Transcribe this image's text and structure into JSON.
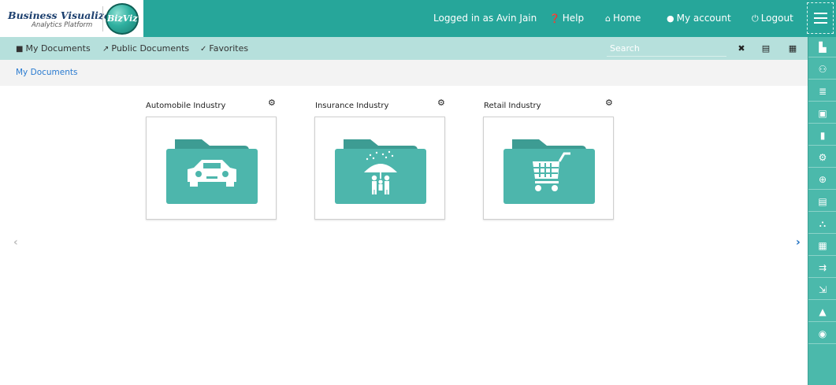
{
  "header": {
    "logo_title": "Business Visualization",
    "logo_subtitle": "Analytics Platform",
    "logo_badge": "BizViz",
    "logged_in": "Logged in as Avin Jain",
    "help": "Help",
    "home": "Home",
    "account": "My account",
    "logout": "Logout"
  },
  "toolbar": {
    "tabs": [
      {
        "label": "My Documents",
        "icon": "folder-icon"
      },
      {
        "label": "Public Documents",
        "icon": "share-icon"
      },
      {
        "label": "Favorites",
        "icon": "favorite-check-icon"
      }
    ],
    "search_placeholder": "Search",
    "clear": "✖",
    "list_view": "▤",
    "grid_view": "▦"
  },
  "breadcrumb": "My Documents",
  "folders": [
    {
      "name": "Automobile Industry",
      "icon": "car-folder-icon"
    },
    {
      "name": "Insurance Industry",
      "icon": "umbrella-family-folder-icon"
    },
    {
      "name": "Retail Industry",
      "icon": "shopping-cart-folder-icon"
    }
  ],
  "nav_arrows": {
    "prev": "‹",
    "next": "›"
  },
  "theme": {
    "teal": "#26a69a",
    "toolbar": "#b6e0dc",
    "folder": "#4db6ac",
    "folder_tab": "#3d9c93",
    "link": "#2a7bd0"
  },
  "rail_icons": [
    "user-folder-icon",
    "users-icon",
    "database-icon",
    "report-search-icon",
    "edit-report-icon",
    "user-settings-icon",
    "zoom-icon",
    "document-icon",
    "org-chart-icon",
    "dashboard-icon",
    "data-flow-icon",
    "export-icon",
    "cloud-drive-icon",
    "globe-icon"
  ]
}
